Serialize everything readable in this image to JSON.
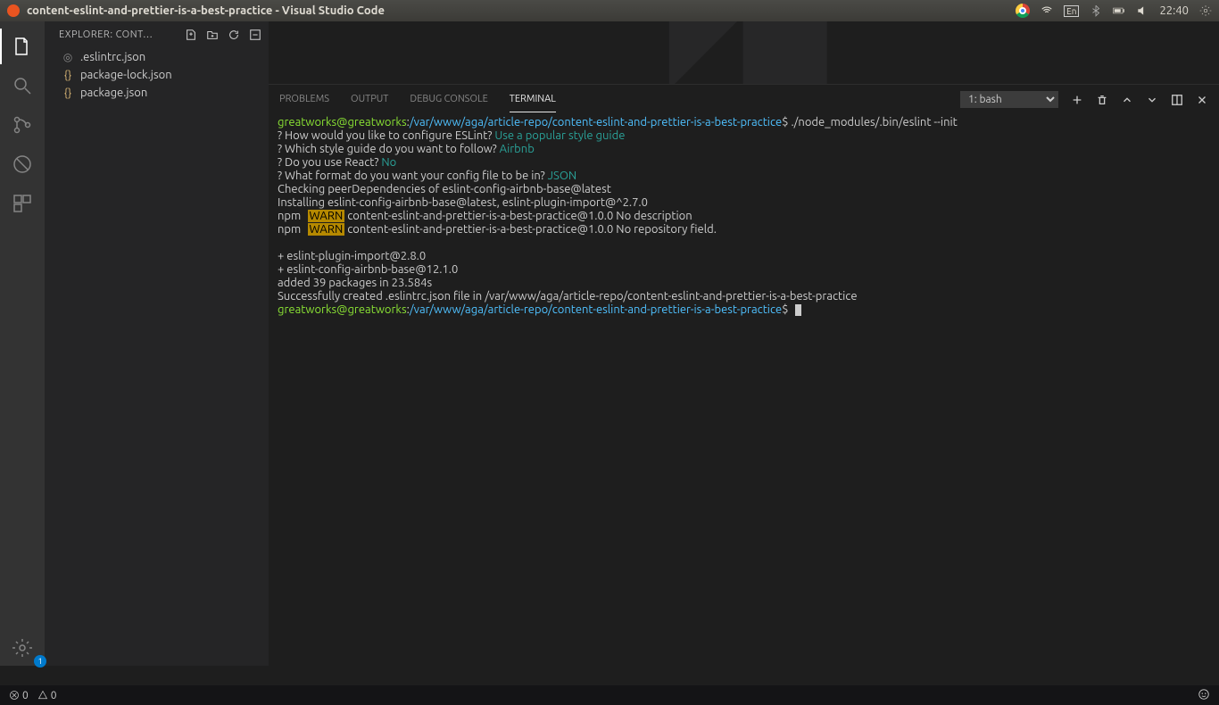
{
  "os": {
    "title": "content-eslint-and-prettier-is-a-best-practice - Visual Studio Code",
    "lang": "En",
    "time": "22:40"
  },
  "sidebar": {
    "header": "EXPLORER: CONT…",
    "files": [
      {
        "name": ".eslintrc.json",
        "icon": "eslint"
      },
      {
        "name": "package-lock.json",
        "icon": "json"
      },
      {
        "name": "package.json",
        "icon": "json"
      }
    ]
  },
  "panel": {
    "tabs": [
      "PROBLEMS",
      "OUTPUT",
      "DEBUG CONSOLE",
      "TERMINAL"
    ],
    "activeTab": "TERMINAL",
    "shell": "1: bash"
  },
  "status": {
    "errors": "0",
    "warnings": "0",
    "gearBadge": "1"
  },
  "term": {
    "user": "greatworks@greatworks",
    "path": "/var/www/aga/article-repo/content-eslint-and-prettier-is-a-best-practice",
    "dollar": "$",
    "cmd1": " ./node_modules/.bin/eslint --init",
    "q1a": "? How would you like to configure ESLint? ",
    "q1b": "Use a popular style guide",
    "q2a": "? Which style guide do you want to follow? ",
    "q2b": "Airbnb",
    "q3a": "? Do you use React? ",
    "q3b": "No",
    "q4a": "? What format do you want your config file to be in? ",
    "q4b": "JSON",
    "l1": "Checking peerDependencies of eslint-config-airbnb-base@latest",
    "l2": "Installing eslint-config-airbnb-base@latest, eslint-plugin-import@^2.7.0",
    "npm": "npm",
    "warn": "WARN",
    "w1": " content-eslint-and-prettier-is-a-best-practice@1.0.0 No description",
    "w2": " content-eslint-and-prettier-is-a-best-practice@1.0.0 No repository field.",
    "p1": "+ eslint-plugin-import@2.8.0",
    "p2": "+ eslint-config-airbnb-base@12.1.0",
    "p3": "added 39 packages in 23.584s",
    "p4": "Successfully created .eslintrc.json file in /var/www/aga/article-repo/content-eslint-and-prettier-is-a-best-practice"
  }
}
